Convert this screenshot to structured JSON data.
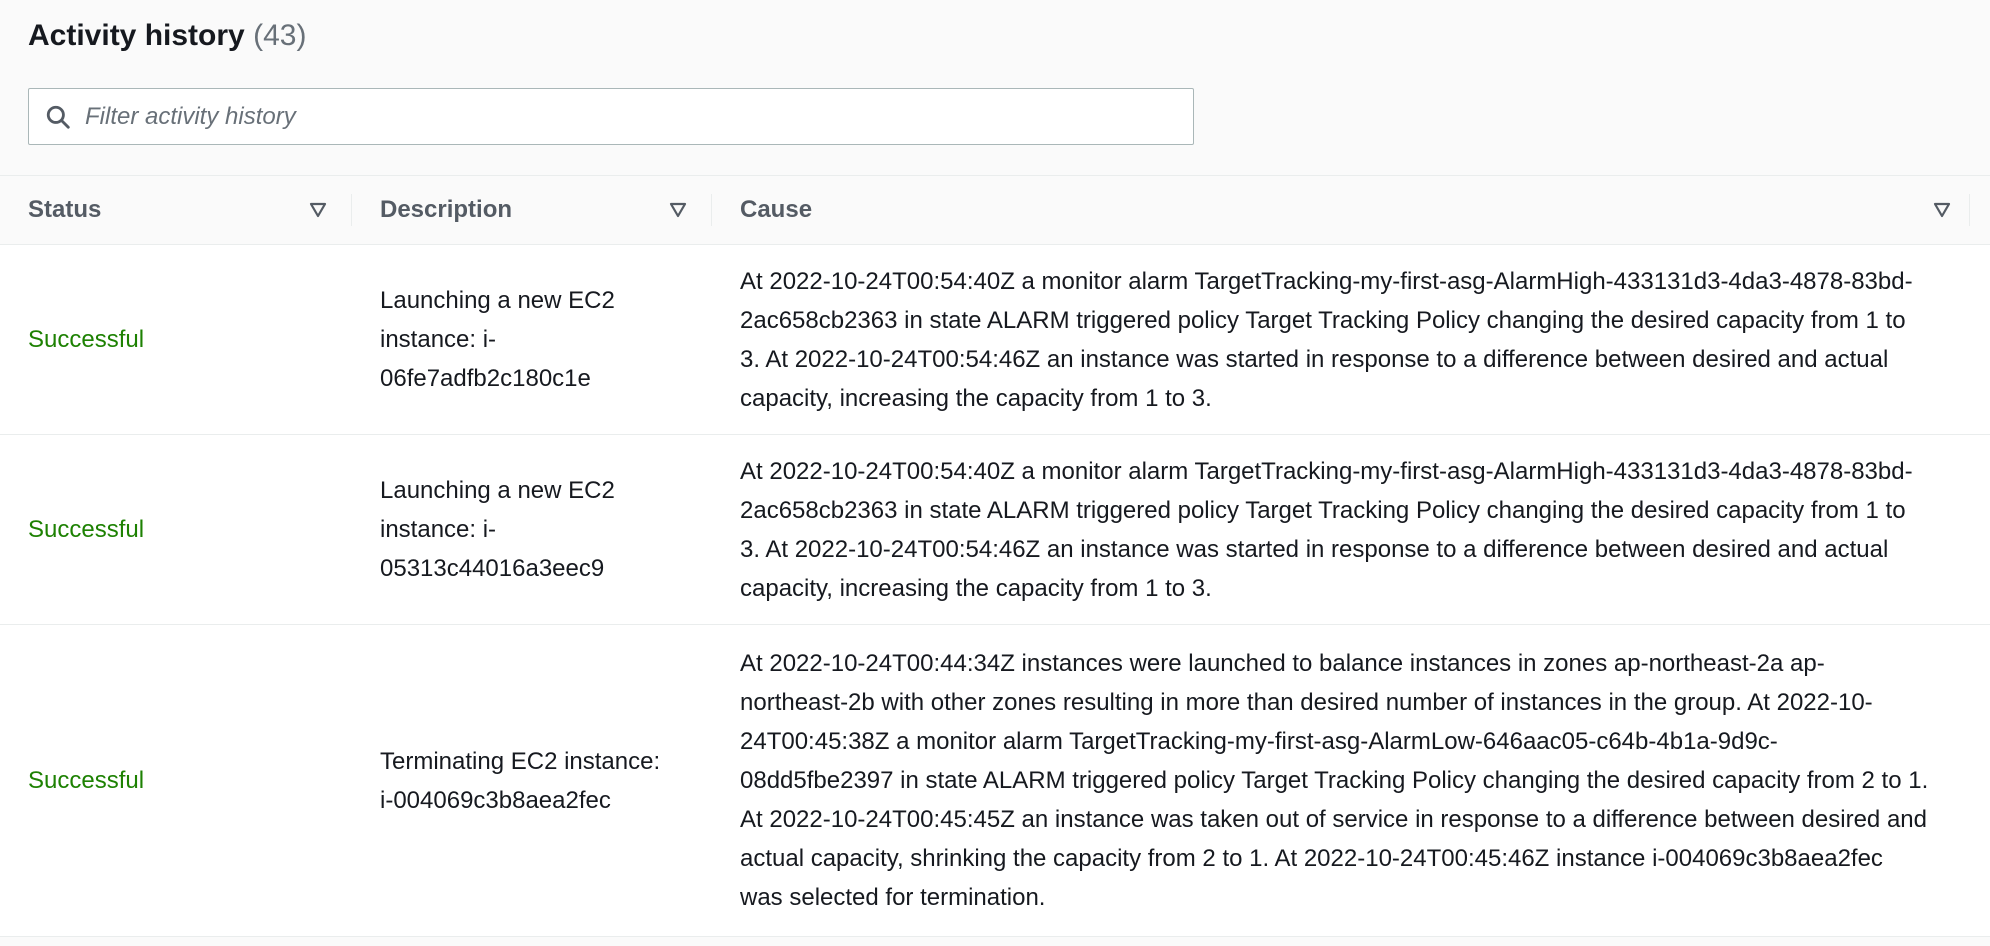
{
  "header": {
    "title": "Activity history",
    "count": "(43)"
  },
  "search": {
    "placeholder": "Filter activity history",
    "value": ""
  },
  "columns": [
    {
      "label": "Status"
    },
    {
      "label": "Description"
    },
    {
      "label": "Cause"
    }
  ],
  "rows": [
    {
      "status": "Successful",
      "description": "Launching a new EC2 instance: i-06fe7adfb2c180c1e",
      "cause": "At 2022-10-24T00:54:40Z a monitor alarm TargetTracking-my-first-asg-AlarmHigh-433131d3-4da3-4878-83bd-2ac658cb2363 in state ALARM triggered policy Target Tracking Policy changing the desired capacity from 1 to 3. At 2022-10-24T00:54:46Z an instance was started in response to a difference between desired and actual capacity, increasing the capacity from 1 to 3."
    },
    {
      "status": "Successful",
      "description": "Launching a new EC2 instance: i-05313c44016a3eec9",
      "cause": "At 2022-10-24T00:54:40Z a monitor alarm TargetTracking-my-first-asg-AlarmHigh-433131d3-4da3-4878-83bd-2ac658cb2363 in state ALARM triggered policy Target Tracking Policy changing the desired capacity from 1 to 3. At 2022-10-24T00:54:46Z an instance was started in response to a difference between desired and actual capacity, increasing the capacity from 1 to 3."
    },
    {
      "status": "Successful",
      "description": "Terminating EC2 instance: i-004069c3b8aea2fec",
      "cause": "At 2022-10-24T00:44:34Z instances were launched to balance instances in zones ap-northeast-2a ap-northeast-2b with other zones resulting in more than desired number of instances in the group. At 2022-10-24T00:45:38Z a monitor alarm TargetTracking-my-first-asg-AlarmLow-646aac05-c64b-4b1a-9d9c-08dd5fbe2397 in state ALARM triggered policy Target Tracking Policy changing the desired capacity from 2 to 1. At 2022-10-24T00:45:45Z an instance was taken out of service in response to a difference between desired and actual capacity, shrinking the capacity from 2 to 1. At 2022-10-24T00:45:46Z instance i-004069c3b8aea2fec was selected for termination."
    }
  ],
  "colors": {
    "success": "#1d8102",
    "header_text": "#545b64",
    "border": "#eaeded"
  }
}
